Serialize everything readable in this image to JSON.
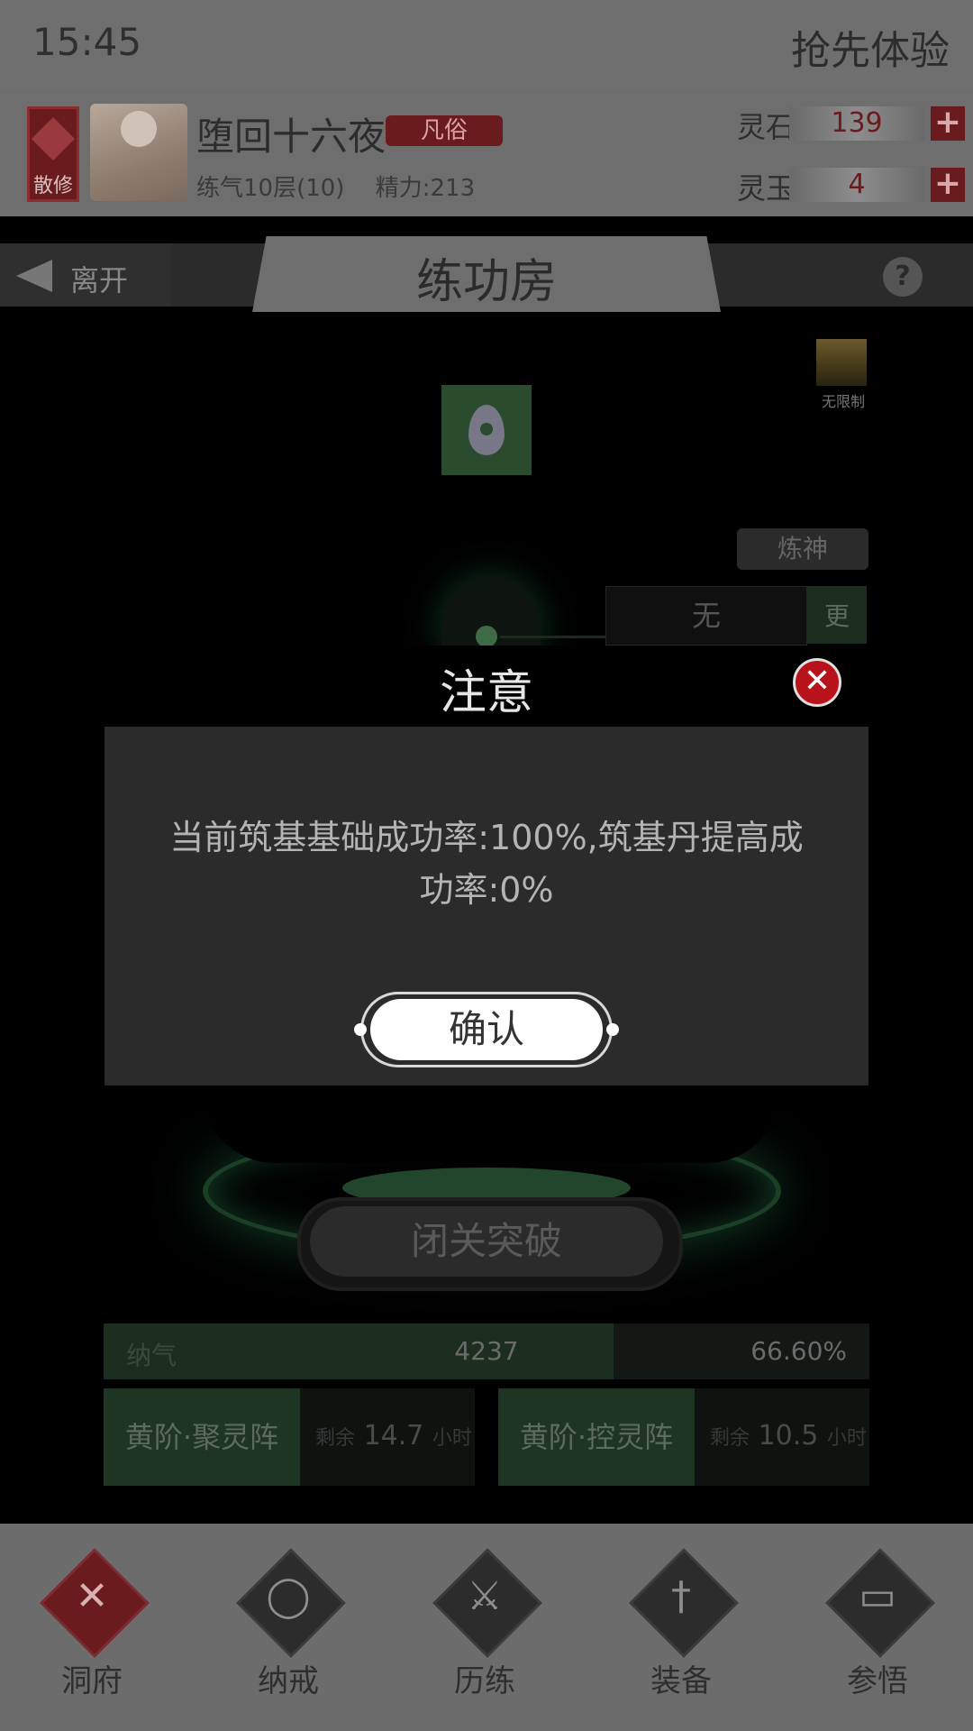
{
  "status_bar": {
    "time": "15:45",
    "early_access": "抢先体验"
  },
  "player": {
    "sect": "散修",
    "name": "堕回十六夜",
    "realm_tag": "凡俗",
    "cultivation": "练气10层(10)",
    "energy": "精力:213"
  },
  "currencies": [
    {
      "label": "灵石",
      "value": "139"
    },
    {
      "label": "灵玉",
      "value": "4"
    }
  ],
  "nav": {
    "back_label": "离开",
    "title": "练功房",
    "help": "?"
  },
  "room": {
    "unlimited_label": "无限制",
    "mode_label": "炼神",
    "slot_value": "无",
    "slot_button": "更",
    "breakthrough_label": "闭关突破",
    "qi": {
      "label": "纳气",
      "value": "4237",
      "percent": "66.60%",
      "fill_fraction": 0.666
    },
    "arrays": [
      {
        "name": "黄阶·聚灵阵",
        "remain_prefix": "剩余",
        "remain_value": "14.7",
        "remain_unit": "小时"
      },
      {
        "name": "黄阶·控灵阵",
        "remain_prefix": "剩余",
        "remain_value": "10.5",
        "remain_unit": "小时"
      }
    ]
  },
  "modal": {
    "title": "注意",
    "message_line1": "当前筑基基础成功率:100%,筑基丹提高成",
    "message_line2": "功率:0%",
    "confirm_label": "确认"
  },
  "bottom_nav": [
    {
      "label": "洞府",
      "icon": "close-x-icon",
      "active": true
    },
    {
      "label": "纳戒",
      "icon": "ring-icon",
      "active": false
    },
    {
      "label": "历练",
      "icon": "crossed-swords-icon",
      "active": false
    },
    {
      "label": "装备",
      "icon": "sword-icon",
      "active": false
    },
    {
      "label": "参悟",
      "icon": "book-icon",
      "active": false
    }
  ],
  "colors": {
    "accent_red": "#6a1b1e",
    "close_red": "#b8121a",
    "jade_green": "#1e3523"
  }
}
